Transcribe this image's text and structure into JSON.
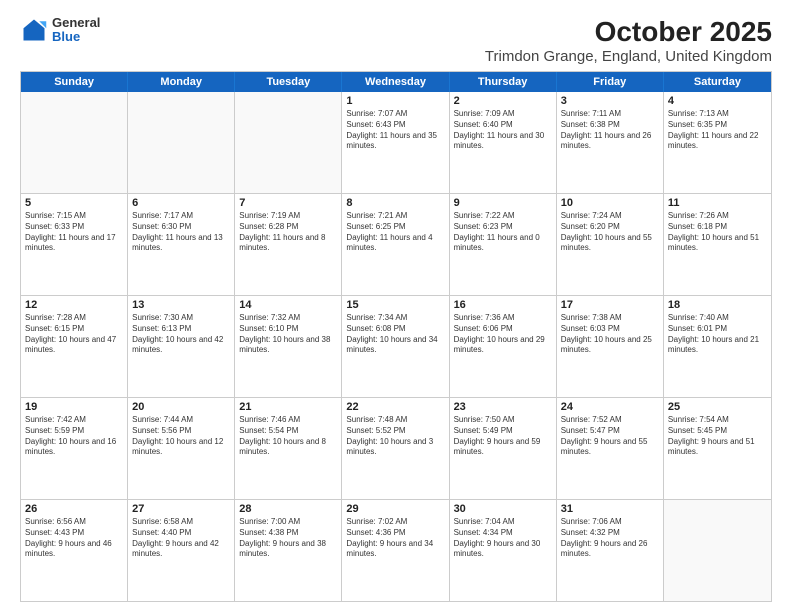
{
  "logo": {
    "line1": "General",
    "line2": "Blue"
  },
  "title": "October 2025",
  "subtitle": "Trimdon Grange, England, United Kingdom",
  "weekdays": [
    "Sunday",
    "Monday",
    "Tuesday",
    "Wednesday",
    "Thursday",
    "Friday",
    "Saturday"
  ],
  "weeks": [
    [
      {
        "day": "",
        "sunrise": "",
        "sunset": "",
        "daylight": ""
      },
      {
        "day": "",
        "sunrise": "",
        "sunset": "",
        "daylight": ""
      },
      {
        "day": "",
        "sunrise": "",
        "sunset": "",
        "daylight": ""
      },
      {
        "day": "1",
        "sunrise": "Sunrise: 7:07 AM",
        "sunset": "Sunset: 6:43 PM",
        "daylight": "Daylight: 11 hours and 35 minutes."
      },
      {
        "day": "2",
        "sunrise": "Sunrise: 7:09 AM",
        "sunset": "Sunset: 6:40 PM",
        "daylight": "Daylight: 11 hours and 30 minutes."
      },
      {
        "day": "3",
        "sunrise": "Sunrise: 7:11 AM",
        "sunset": "Sunset: 6:38 PM",
        "daylight": "Daylight: 11 hours and 26 minutes."
      },
      {
        "day": "4",
        "sunrise": "Sunrise: 7:13 AM",
        "sunset": "Sunset: 6:35 PM",
        "daylight": "Daylight: 11 hours and 22 minutes."
      }
    ],
    [
      {
        "day": "5",
        "sunrise": "Sunrise: 7:15 AM",
        "sunset": "Sunset: 6:33 PM",
        "daylight": "Daylight: 11 hours and 17 minutes."
      },
      {
        "day": "6",
        "sunrise": "Sunrise: 7:17 AM",
        "sunset": "Sunset: 6:30 PM",
        "daylight": "Daylight: 11 hours and 13 minutes."
      },
      {
        "day": "7",
        "sunrise": "Sunrise: 7:19 AM",
        "sunset": "Sunset: 6:28 PM",
        "daylight": "Daylight: 11 hours and 8 minutes."
      },
      {
        "day": "8",
        "sunrise": "Sunrise: 7:21 AM",
        "sunset": "Sunset: 6:25 PM",
        "daylight": "Daylight: 11 hours and 4 minutes."
      },
      {
        "day": "9",
        "sunrise": "Sunrise: 7:22 AM",
        "sunset": "Sunset: 6:23 PM",
        "daylight": "Daylight: 11 hours and 0 minutes."
      },
      {
        "day": "10",
        "sunrise": "Sunrise: 7:24 AM",
        "sunset": "Sunset: 6:20 PM",
        "daylight": "Daylight: 10 hours and 55 minutes."
      },
      {
        "day": "11",
        "sunrise": "Sunrise: 7:26 AM",
        "sunset": "Sunset: 6:18 PM",
        "daylight": "Daylight: 10 hours and 51 minutes."
      }
    ],
    [
      {
        "day": "12",
        "sunrise": "Sunrise: 7:28 AM",
        "sunset": "Sunset: 6:15 PM",
        "daylight": "Daylight: 10 hours and 47 minutes."
      },
      {
        "day": "13",
        "sunrise": "Sunrise: 7:30 AM",
        "sunset": "Sunset: 6:13 PM",
        "daylight": "Daylight: 10 hours and 42 minutes."
      },
      {
        "day": "14",
        "sunrise": "Sunrise: 7:32 AM",
        "sunset": "Sunset: 6:10 PM",
        "daylight": "Daylight: 10 hours and 38 minutes."
      },
      {
        "day": "15",
        "sunrise": "Sunrise: 7:34 AM",
        "sunset": "Sunset: 6:08 PM",
        "daylight": "Daylight: 10 hours and 34 minutes."
      },
      {
        "day": "16",
        "sunrise": "Sunrise: 7:36 AM",
        "sunset": "Sunset: 6:06 PM",
        "daylight": "Daylight: 10 hours and 29 minutes."
      },
      {
        "day": "17",
        "sunrise": "Sunrise: 7:38 AM",
        "sunset": "Sunset: 6:03 PM",
        "daylight": "Daylight: 10 hours and 25 minutes."
      },
      {
        "day": "18",
        "sunrise": "Sunrise: 7:40 AM",
        "sunset": "Sunset: 6:01 PM",
        "daylight": "Daylight: 10 hours and 21 minutes."
      }
    ],
    [
      {
        "day": "19",
        "sunrise": "Sunrise: 7:42 AM",
        "sunset": "Sunset: 5:59 PM",
        "daylight": "Daylight: 10 hours and 16 minutes."
      },
      {
        "day": "20",
        "sunrise": "Sunrise: 7:44 AM",
        "sunset": "Sunset: 5:56 PM",
        "daylight": "Daylight: 10 hours and 12 minutes."
      },
      {
        "day": "21",
        "sunrise": "Sunrise: 7:46 AM",
        "sunset": "Sunset: 5:54 PM",
        "daylight": "Daylight: 10 hours and 8 minutes."
      },
      {
        "day": "22",
        "sunrise": "Sunrise: 7:48 AM",
        "sunset": "Sunset: 5:52 PM",
        "daylight": "Daylight: 10 hours and 3 minutes."
      },
      {
        "day": "23",
        "sunrise": "Sunrise: 7:50 AM",
        "sunset": "Sunset: 5:49 PM",
        "daylight": "Daylight: 9 hours and 59 minutes."
      },
      {
        "day": "24",
        "sunrise": "Sunrise: 7:52 AM",
        "sunset": "Sunset: 5:47 PM",
        "daylight": "Daylight: 9 hours and 55 minutes."
      },
      {
        "day": "25",
        "sunrise": "Sunrise: 7:54 AM",
        "sunset": "Sunset: 5:45 PM",
        "daylight": "Daylight: 9 hours and 51 minutes."
      }
    ],
    [
      {
        "day": "26",
        "sunrise": "Sunrise: 6:56 AM",
        "sunset": "Sunset: 4:43 PM",
        "daylight": "Daylight: 9 hours and 46 minutes."
      },
      {
        "day": "27",
        "sunrise": "Sunrise: 6:58 AM",
        "sunset": "Sunset: 4:40 PM",
        "daylight": "Daylight: 9 hours and 42 minutes."
      },
      {
        "day": "28",
        "sunrise": "Sunrise: 7:00 AM",
        "sunset": "Sunset: 4:38 PM",
        "daylight": "Daylight: 9 hours and 38 minutes."
      },
      {
        "day": "29",
        "sunrise": "Sunrise: 7:02 AM",
        "sunset": "Sunset: 4:36 PM",
        "daylight": "Daylight: 9 hours and 34 minutes."
      },
      {
        "day": "30",
        "sunrise": "Sunrise: 7:04 AM",
        "sunset": "Sunset: 4:34 PM",
        "daylight": "Daylight: 9 hours and 30 minutes."
      },
      {
        "day": "31",
        "sunrise": "Sunrise: 7:06 AM",
        "sunset": "Sunset: 4:32 PM",
        "daylight": "Daylight: 9 hours and 26 minutes."
      },
      {
        "day": "",
        "sunrise": "",
        "sunset": "",
        "daylight": ""
      }
    ]
  ]
}
